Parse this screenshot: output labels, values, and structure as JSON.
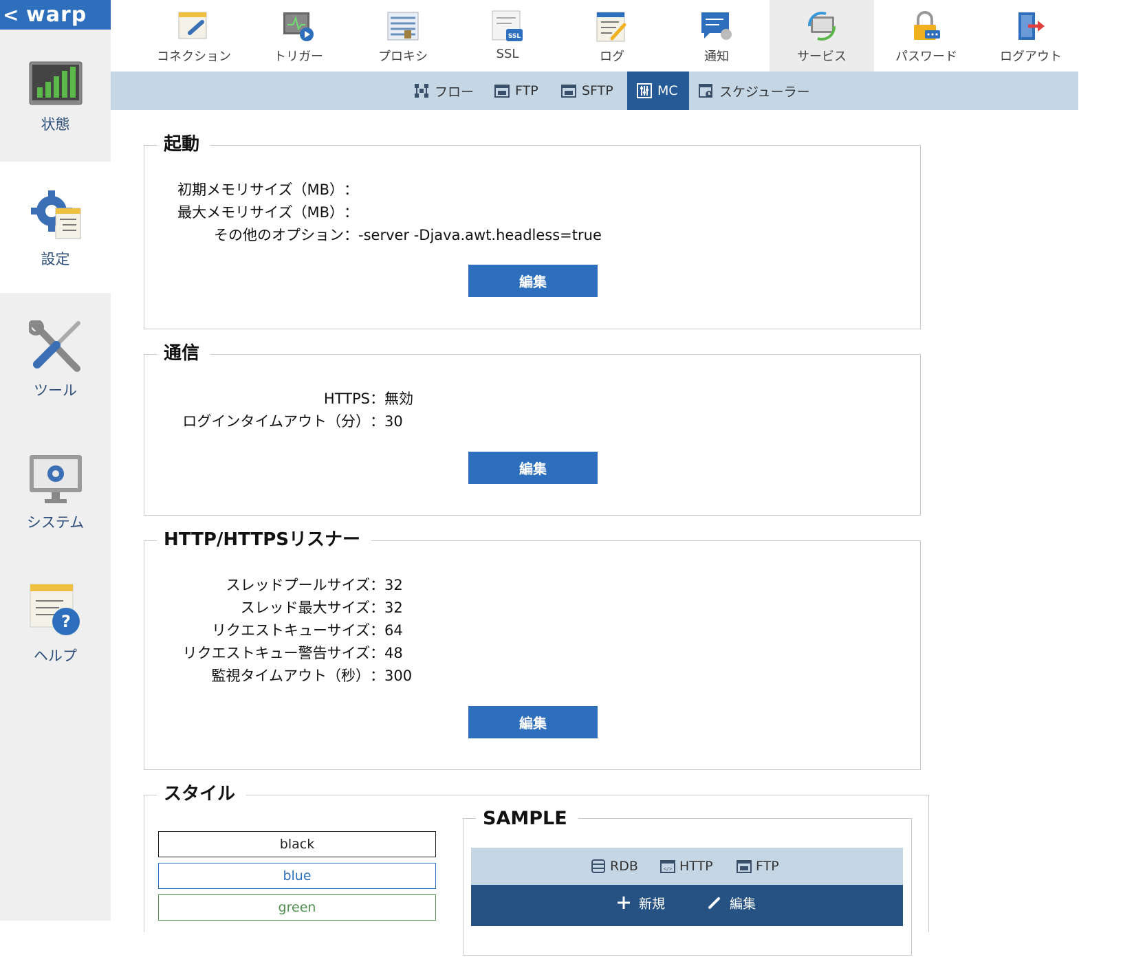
{
  "brand": {
    "back": "<",
    "name": "warp"
  },
  "sidebar": {
    "items": [
      {
        "label": "状態",
        "icon": "chart-bars-icon"
      },
      {
        "label": "設定",
        "icon": "gear-settings-icon"
      },
      {
        "label": "ツール",
        "icon": "wrench-screwdriver-icon"
      },
      {
        "label": "システム",
        "icon": "monitor-gear-icon"
      },
      {
        "label": "ヘルプ",
        "icon": "help-document-icon"
      }
    ],
    "active": "設定"
  },
  "topnav": {
    "items": [
      {
        "label": "コネクション",
        "icon": "connection-icon"
      },
      {
        "label": "トリガー",
        "icon": "trigger-icon"
      },
      {
        "label": "プロキシ",
        "icon": "proxy-icon"
      },
      {
        "label": "SSL",
        "icon": "ssl-icon"
      },
      {
        "label": "ログ",
        "icon": "log-icon"
      },
      {
        "label": "通知",
        "icon": "notification-icon"
      },
      {
        "label": "サービス",
        "icon": "service-icon"
      },
      {
        "label": "パスワード",
        "icon": "password-lock-icon"
      },
      {
        "label": "ログアウト",
        "icon": "logout-icon"
      }
    ],
    "active": "サービス"
  },
  "subnav": {
    "items": [
      {
        "label": "フロー",
        "icon": "flow-icon"
      },
      {
        "label": "FTP",
        "icon": "ftp-icon"
      },
      {
        "label": "SFTP",
        "icon": "sftp-icon"
      },
      {
        "label": "MC",
        "icon": "mc-sliders-icon"
      },
      {
        "label": "スケジューラー",
        "icon": "scheduler-icon"
      }
    ],
    "active": "MC"
  },
  "sections": {
    "startup": {
      "title": "起動",
      "rows": [
        {
          "key": "初期メモリサイズ（MB）",
          "sep": "：",
          "value": ""
        },
        {
          "key": "最大メモリサイズ（MB）",
          "sep": "：",
          "value": ""
        },
        {
          "key": "その他のオプション",
          "sep": "：",
          "value": "-server -Djava.awt.headless=true"
        }
      ],
      "button": "編集"
    },
    "comm": {
      "title": "通信",
      "rows": [
        {
          "key": "HTTPS",
          "sep": "：",
          "value": "無効"
        },
        {
          "key": "ログインタイムアウト（分）",
          "sep": "：",
          "value": "30"
        }
      ],
      "button": "編集"
    },
    "listener": {
      "title": "HTTP/HTTPSリスナー",
      "rows": [
        {
          "key": "スレッドプールサイズ",
          "sep": "：",
          "value": "32"
        },
        {
          "key": "スレッド最大サイズ",
          "sep": "：",
          "value": "32"
        },
        {
          "key": "リクエストキューサイズ",
          "sep": "：",
          "value": "64"
        },
        {
          "key": "リクエストキュー警告サイズ",
          "sep": "：",
          "value": "48"
        },
        {
          "key": "監視タイムアウト（秒）",
          "sep": "：",
          "value": "300"
        }
      ],
      "button": "編集"
    },
    "style": {
      "title": "スタイル",
      "options": [
        {
          "label": "black",
          "color": "#222222"
        },
        {
          "label": "blue",
          "color": "#2e6fbd"
        },
        {
          "label": "green",
          "color": "#4f8f4f"
        }
      ],
      "sample": {
        "title": "SAMPLE",
        "tabs": [
          {
            "label": "RDB",
            "icon": "database-icon"
          },
          {
            "label": "HTTP",
            "icon": "http-icon"
          },
          {
            "label": "FTP",
            "icon": "ftp-icon"
          }
        ],
        "actions": [
          {
            "label": "新規",
            "icon": "plus-icon"
          },
          {
            "label": "編集",
            "icon": "pencil-icon"
          }
        ]
      }
    }
  },
  "colors": {
    "accent": "#2e6fbd",
    "subnav_bg": "#c5d6e5",
    "subnav_active": "#265a96",
    "sample_dark": "#255283"
  }
}
